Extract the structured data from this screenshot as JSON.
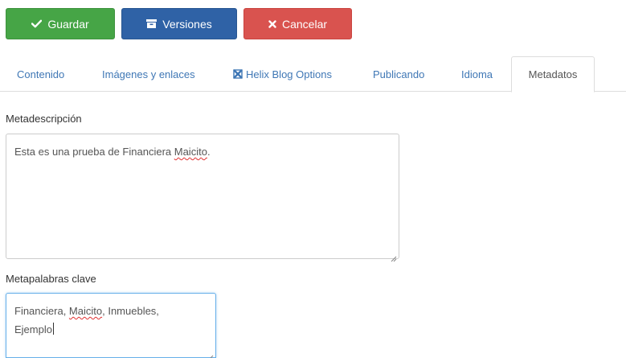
{
  "toolbar": {
    "save": {
      "label": "Guardar",
      "icon": "check-icon",
      "color": "#46a546"
    },
    "versions": {
      "label": "Versiones",
      "icon": "archive-icon",
      "color": "#2f62a6"
    },
    "cancel": {
      "label": "Cancelar",
      "icon": "close-icon",
      "color": "#d9534f"
    }
  },
  "tabs": [
    {
      "label": "Contenido",
      "active": false
    },
    {
      "label": "Imágenes y enlaces",
      "active": false
    },
    {
      "label": "Helix Blog Options",
      "active": false,
      "icon": "helix-icon"
    },
    {
      "label": "Publicando",
      "active": false
    },
    {
      "label": "Idioma",
      "active": false
    },
    {
      "label": "Metadatos",
      "active": true
    }
  ],
  "metadesc": {
    "label": "Metadescripción",
    "value_before": "Esta es una prueba de Financiera ",
    "value_misspelled": "Maicito",
    "value_after": "."
  },
  "metakeys": {
    "label": "Metapalabras clave",
    "line1_before": "Financiera, ",
    "line1_misspelled": "Maicito",
    "line1_after": ", Inmuebles,",
    "line2": "Ejemplo"
  },
  "colors": {
    "link": "#3f77b5",
    "focus_border": "#66afe9",
    "spell_error": "#e03030"
  }
}
